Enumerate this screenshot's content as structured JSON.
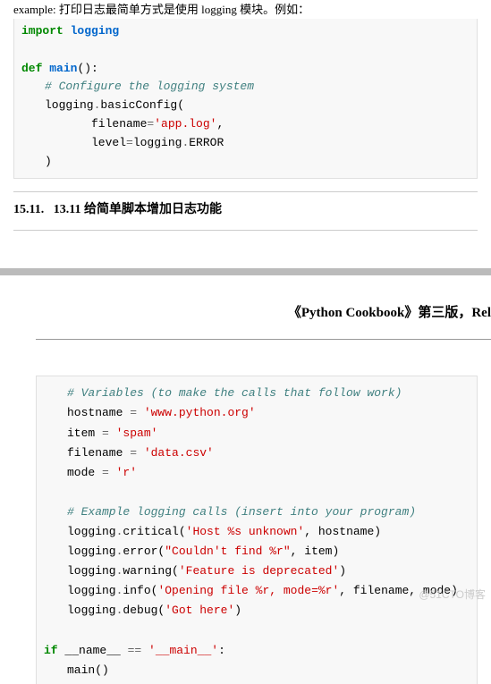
{
  "preText": "example: 打印日志最简单方式是使用 logging 模块。例如：",
  "code1": {
    "l1a": "import",
    "l1b": "logging",
    "l2a": "def",
    "l2b": "main",
    "l2c": "():",
    "l3": "# Configure the logging system",
    "l4a": "logging",
    "l4b": ".",
    "l4c": "basicConfig(",
    "l5a": "filename",
    "l5b": "=",
    "l5c": "'app.log'",
    "l5d": ",",
    "l6a": "level",
    "l6b": "=",
    "l6c": "logging",
    "l6d": ".",
    "l6e": "ERROR",
    "l7": ")"
  },
  "sectionNum": "15.11.",
  "sectionTitle": "13.11 给简单脚本增加日志功能",
  "bookTitle": "《Python Cookbook》第三版，Rel",
  "code2": {
    "c1": "# Variables (to make the calls that follow work)",
    "c2a": "hostname ",
    "c2b": "=",
    "c2c": " 'www.python.org'",
    "c3a": "item ",
    "c3b": "=",
    "c3c": " 'spam'",
    "c4a": "filename ",
    "c4b": "=",
    "c4c": " 'data.csv'",
    "c5a": "mode ",
    "c5b": "=",
    "c5c": " 'r'",
    "c6": "# Example logging calls (insert into your program)",
    "c7a": "logging",
    "c7b": ".",
    "c7c": "critical(",
    "c7d": "'Host %s unknown'",
    "c7e": ", hostname)",
    "c8a": "logging",
    "c8b": ".",
    "c8c": "error(",
    "c8d": "\"Couldn't find %r\"",
    "c8e": ", item)",
    "c9a": "logging",
    "c9b": ".",
    "c9c": "warning(",
    "c9d": "'Feature is deprecated'",
    "c9e": ")",
    "c10a": "logging",
    "c10b": ".",
    "c10c": "info(",
    "c10d": "'Opening file %r, mode=%r'",
    "c10e": ", filename, mode)",
    "c11a": "logging",
    "c11b": ".",
    "c11c": "debug(",
    "c11d": "'Got here'",
    "c11e": ")",
    "c12a": "if",
    "c12b": " __name__ ",
    "c12c": "==",
    "c12d": " '__main__'",
    "c12e": ":",
    "c13": "main()"
  },
  "watermark": "@51CTO博客"
}
